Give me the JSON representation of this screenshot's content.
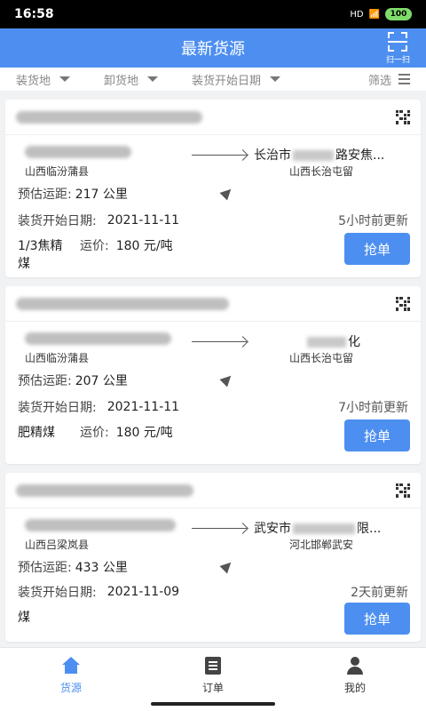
{
  "status": {
    "time": "16:58",
    "signal": "HD",
    "battery": "100"
  },
  "header": {
    "title": "最新货源",
    "scan_label": "扫一扫"
  },
  "filters": [
    {
      "label": "装货地"
    },
    {
      "label": "卸货地"
    },
    {
      "label": "装货开始日期"
    },
    {
      "label": "筛选"
    }
  ],
  "cards": [
    {
      "from_province": "山西临汾蒲县",
      "to_name": "长治市",
      "to_name_suffix": "路安焦...",
      "to_province": "山西长治屯留",
      "distance_label": "预估运距:",
      "distance": "217 公里",
      "date_label": "装货开始日期:",
      "date": "2021-11-11",
      "updated": "5小时前更新",
      "cargo": "1/3焦精煤",
      "price_label": "运价:",
      "price": "180 元/吨",
      "button": "抢单"
    },
    {
      "from_province": "山西临汾蒲县",
      "to_name": "",
      "to_name_suffix": "化",
      "to_province": "山西长治屯留",
      "distance_label": "预估运距:",
      "distance": "207 公里",
      "date_label": "装货开始日期:",
      "date": "2021-11-11",
      "updated": "7小时前更新",
      "cargo": "肥精煤",
      "price_label": "运价:",
      "price": "180 元/吨",
      "button": "抢单"
    },
    {
      "from_province": "山西吕梁岚县",
      "to_name": "武安市",
      "to_name_suffix": "限...",
      "to_province": "河北邯郸武安",
      "distance_label": "预估运距:",
      "distance": "433 公里",
      "date_label": "装货开始日期:",
      "date": "2021-11-09",
      "updated": "2天前更新",
      "cargo": "煤",
      "price_label": "",
      "price": "",
      "button": "抢单"
    }
  ],
  "tabs": [
    {
      "label": "货源"
    },
    {
      "label": "订单"
    },
    {
      "label": "我的"
    }
  ]
}
